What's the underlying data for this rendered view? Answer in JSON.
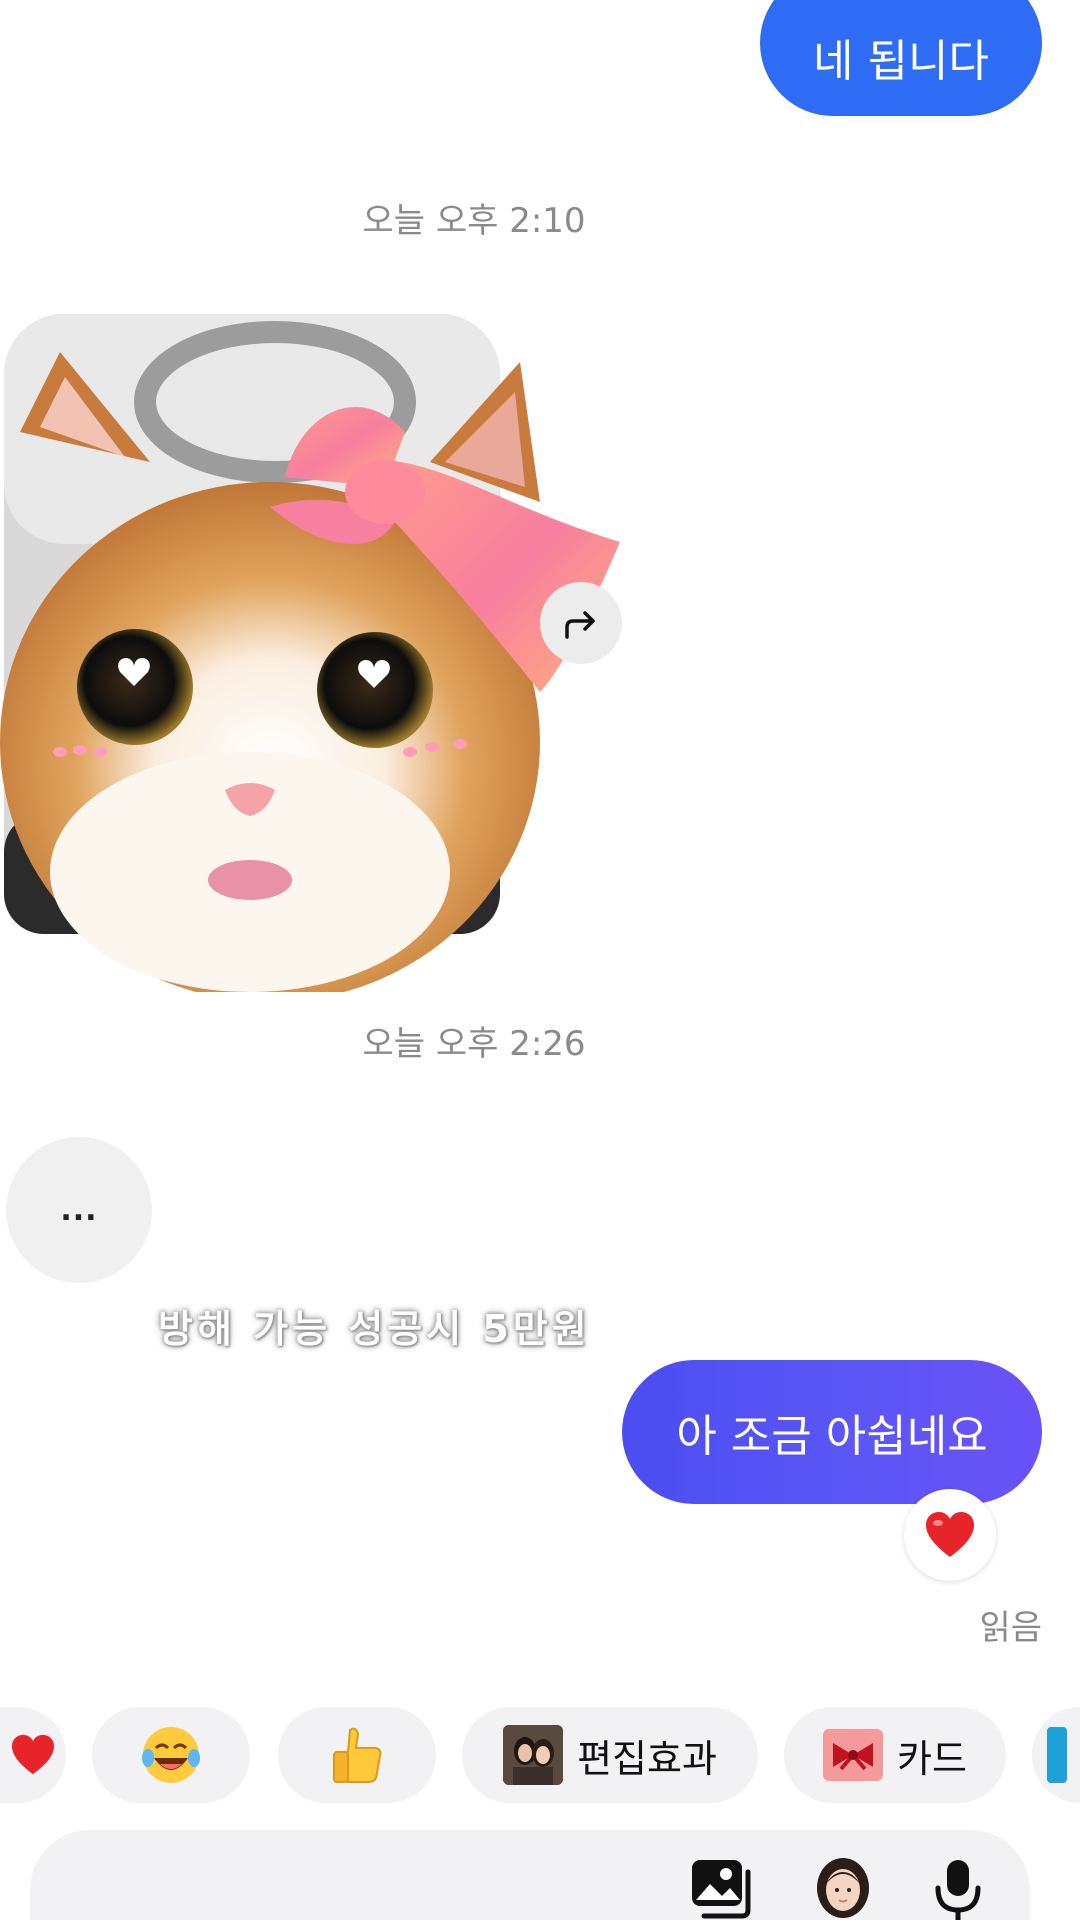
{
  "messages": {
    "sent_top": "네 됩니다",
    "timestamp_1": "오늘 오후 2:10",
    "timestamp_2": "오늘 오후 2:26",
    "typing_indicator": "...",
    "overlay_caption": "방해 가능 성공시 5만원",
    "sent_bottom": "아 조금 아쉽네요",
    "reaction_icon": "heart-icon",
    "read_receipt": "읽음"
  },
  "sticker": {
    "icon": "cat-with-bow-sticker",
    "forward_icon": "forward-icon"
  },
  "quick_replies": [
    {
      "icon": "heart-icon",
      "label": ""
    },
    {
      "icon": "laughing-tears-emoji",
      "label": ""
    },
    {
      "icon": "thumbs-up-emoji",
      "label": ""
    },
    {
      "icon": "photo-thumbnail",
      "label": "편집효과"
    },
    {
      "icon": "ribbon-card-icon",
      "label": "카드"
    }
  ],
  "composer": {
    "icons": [
      "gallery-icon",
      "avatar-icon",
      "microphone-icon"
    ]
  },
  "colors": {
    "sent_bubble_blue": "#2f6cf6",
    "sent_bubble_purple": "#5b56f5",
    "timestamp_gray": "#8a8a8a",
    "chip_bg": "#f2f2f4"
  }
}
